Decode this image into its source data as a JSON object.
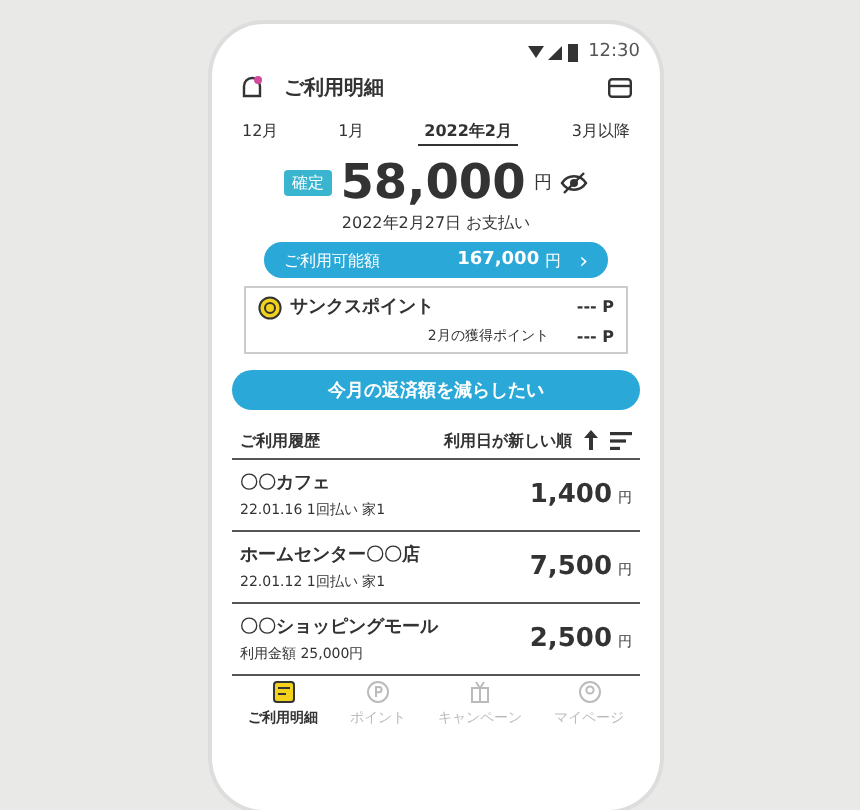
{
  "status_bar": {
    "time": "12:30"
  },
  "header": {
    "title": "ご利用明細"
  },
  "tabs": [
    {
      "label": "12月",
      "selected": false
    },
    {
      "label": "1月",
      "selected": false
    },
    {
      "label": "2022年2月",
      "selected": true
    },
    {
      "label": "3月以降",
      "selected": false
    }
  ],
  "summary": {
    "badge": "確定",
    "amount": "58,000",
    "unit": "円",
    "due_date": "2022年2月27日 お支払い"
  },
  "available": {
    "label": "ご利用可能額",
    "amount": "167,000",
    "unit": "円",
    "chevron": "›"
  },
  "points": {
    "title": "サンクスポイント",
    "value": "--- P",
    "sub_label": "2月の獲得ポイント",
    "sub_value": "--- P"
  },
  "reduce_button": "今月の返済額を減らしたい",
  "history": {
    "title": "ご利用履歴",
    "sort_label": "利用日が新しい順",
    "rows": [
      {
        "name": "〇〇カフェ",
        "detail": "22.01.16  1回払い  家1",
        "amount": "1,400",
        "unit": "円"
      },
      {
        "name": "ホームセンター〇〇店",
        "detail": "22.01.12  1回払い  家1",
        "amount": "7,500",
        "unit": "円"
      },
      {
        "name": "〇〇ショッピングモール",
        "detail": "利用金額 25,000円",
        "amount": "2,500",
        "unit": "円"
      }
    ]
  },
  "nav": [
    {
      "label": "ご利用明細",
      "selected": true
    },
    {
      "label": "ポイント",
      "selected": false
    },
    {
      "label": "キャンペーン",
      "selected": false
    },
    {
      "label": "マイページ",
      "selected": false
    }
  ]
}
